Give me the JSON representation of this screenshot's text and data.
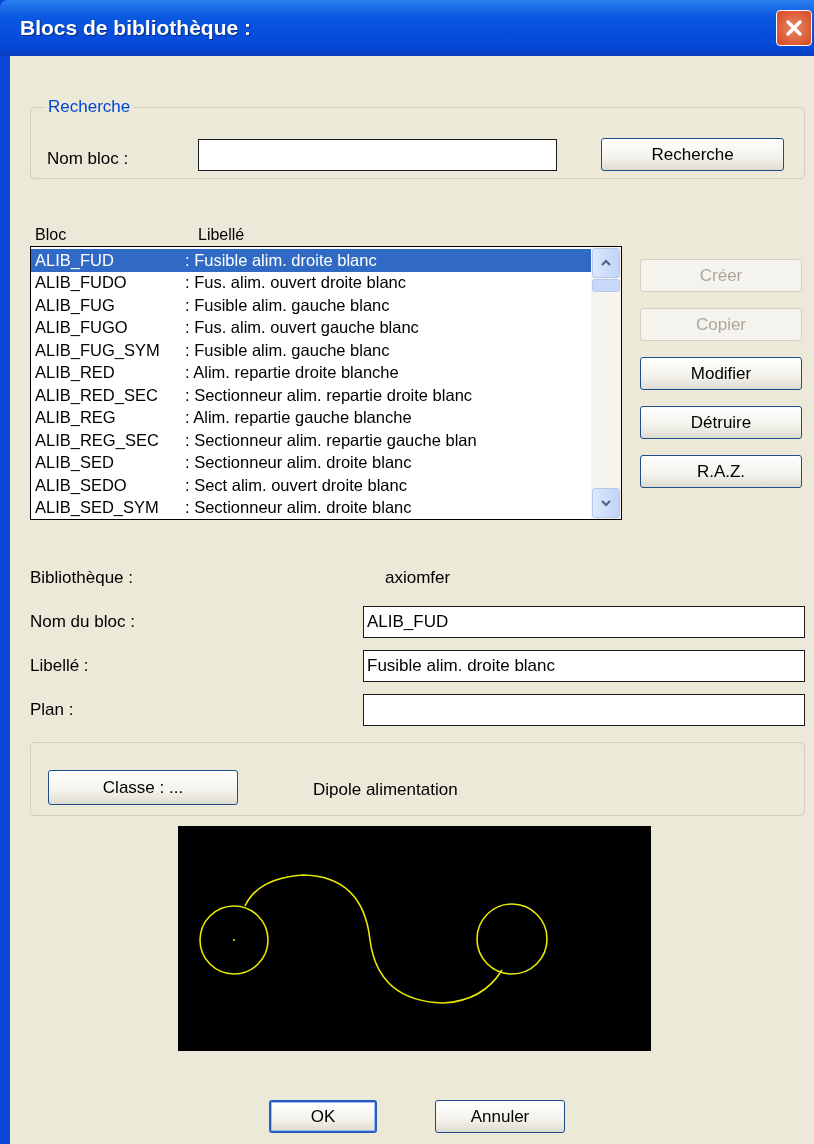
{
  "window": {
    "title": "Blocs de bibliothèque :"
  },
  "search": {
    "legend": "Recherche",
    "label": "Nom bloc :",
    "button": "Recherche"
  },
  "list": {
    "columns": [
      "Bloc",
      "Libellé"
    ],
    "rows": [
      {
        "bloc": "ALIB_FUD",
        "label": ": Fusible alim. droite blanc",
        "selected": true
      },
      {
        "bloc": "ALIB_FUDO",
        "label": ": Fus. alim. ouvert droite blanc",
        "selected": false
      },
      {
        "bloc": "ALIB_FUG",
        "label": ": Fusible alim. gauche blanc",
        "selected": false
      },
      {
        "bloc": "ALIB_FUGO",
        "label": ": Fus. alim. ouvert gauche blanc",
        "selected": false
      },
      {
        "bloc": "ALIB_FUG_SYM",
        "label": ": Fusible alim. gauche blanc",
        "selected": false
      },
      {
        "bloc": "ALIB_RED",
        "label": ": Alim. repartie droite blanche",
        "selected": false
      },
      {
        "bloc": "ALIB_RED_SEC",
        "label": ": Sectionneur alim. repartie droite blanc",
        "selected": false
      },
      {
        "bloc": "ALIB_REG",
        "label": ": Alim. repartie gauche blanche",
        "selected": false
      },
      {
        "bloc": "ALIB_REG_SEC",
        "label": ": Sectionneur alim. repartie gauche blan",
        "selected": false
      },
      {
        "bloc": "ALIB_SED",
        "label": ": Sectionneur alim. droite blanc",
        "selected": false
      },
      {
        "bloc": "ALIB_SEDO",
        "label": ": Sect alim. ouvert droite blanc",
        "selected": false
      },
      {
        "bloc": "ALIB_SED_SYM",
        "label": ": Sectionneur alim. droite blanc",
        "selected": false
      }
    ]
  },
  "actions": [
    {
      "label": "Créer",
      "disabled": true
    },
    {
      "label": "Copier",
      "disabled": true
    },
    {
      "label": "Modifier",
      "disabled": false
    },
    {
      "label": "Détruire",
      "disabled": false
    },
    {
      "label": "R.A.Z.",
      "disabled": false
    }
  ],
  "details": {
    "library_label": "Bibliothèque :",
    "library_value": "axiomfer",
    "fields": [
      {
        "label": "Nom du bloc :",
        "value": "ALIB_FUD"
      },
      {
        "label": "Libellé :",
        "value": "Fusible alim. droite blanc"
      },
      {
        "label": "Plan :"
      }
    ]
  },
  "class": {
    "button": "Classe :  ...",
    "value": "Dipole alimentation"
  },
  "buttons": [
    {
      "label": "OK",
      "default": true
    },
    {
      "label": "Annuler",
      "default": false
    }
  ]
}
